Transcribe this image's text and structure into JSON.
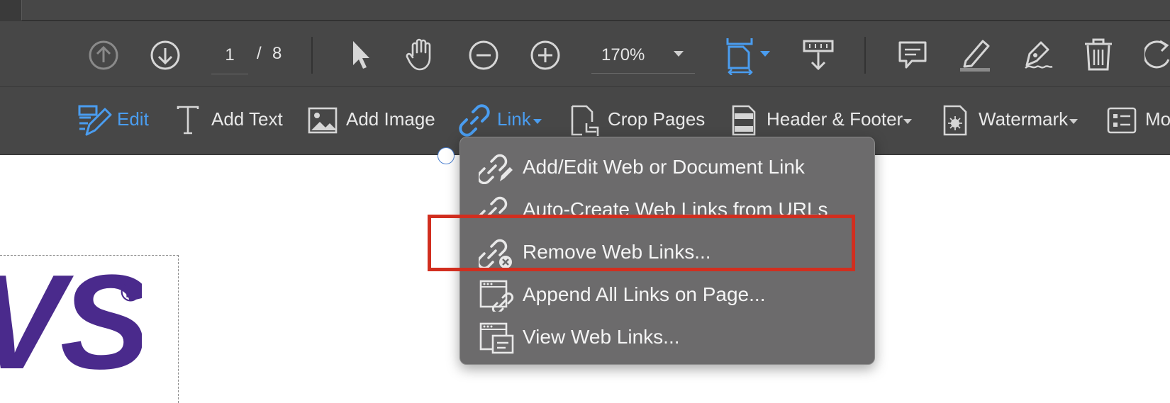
{
  "toolbar": {
    "page_current": "1",
    "page_separator": "/",
    "page_total": "8",
    "zoom_level": "170%"
  },
  "edit_toolbar": {
    "edit_label": "Edit",
    "add_text_label": "Add Text",
    "add_image_label": "Add Image",
    "link_label": "Link",
    "crop_pages_label": "Crop Pages",
    "header_footer_label": "Header & Footer",
    "watermark_label": "Watermark",
    "more_label": "Mo"
  },
  "link_menu": {
    "items": [
      {
        "label": "Add/Edit Web or Document Link"
      },
      {
        "label": "Auto-Create Web Links from URLs"
      },
      {
        "label": "Remove Web Links..."
      },
      {
        "label": "Append All Links on Page..."
      },
      {
        "label": "View Web Links..."
      }
    ]
  },
  "document": {
    "logo_text": "VS",
    "registered_mark": "®"
  },
  "colors": {
    "toolbar_bg": "#474747",
    "accent_blue": "#4a9df0",
    "menu_bg": "#6c6b6c",
    "highlight_red": "#d12e1f",
    "logo_purple": "#4a2a8c"
  }
}
